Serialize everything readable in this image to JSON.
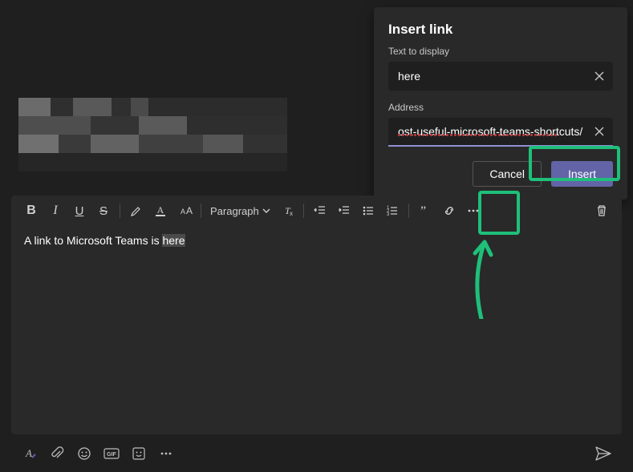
{
  "dialog": {
    "title": "Insert link",
    "text_label": "Text to display",
    "text_value": "here",
    "address_label": "Address",
    "address_value": "ost-useful-microsoft-teams-shortcuts/",
    "cancel_label": "Cancel",
    "insert_label": "Insert"
  },
  "toolbar": {
    "paragraph_label": "Paragraph"
  },
  "compose": {
    "text_prefix": "A link to Microsoft Teams is ",
    "text_selected": "here"
  },
  "icons": {
    "bold": "B",
    "italic": "I",
    "underline": "U",
    "strike": "S",
    "font_small": "A",
    "font_small2": "A"
  }
}
